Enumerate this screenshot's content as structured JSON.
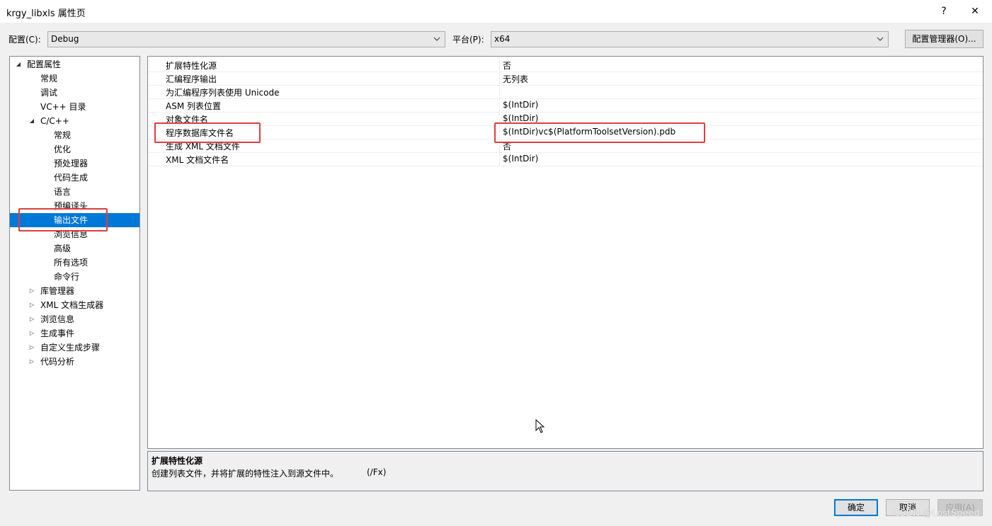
{
  "window": {
    "title": "krgy_libxls 属性页",
    "help_glyph": "?",
    "close_glyph": "✕"
  },
  "toolbar": {
    "config_label": "配置(C):",
    "config_value": "Debug",
    "platform_label": "平台(P):",
    "platform_value": "x64",
    "config_manager": "配置管理器(O)..."
  },
  "tree": {
    "items": [
      {
        "label": "配置属性",
        "arrow": "◢"
      },
      {
        "label": "常规"
      },
      {
        "label": "调试"
      },
      {
        "label": "VC++ 目录"
      },
      {
        "label": "C/C++",
        "arrow": "◢"
      },
      {
        "label": "常规"
      },
      {
        "label": "优化"
      },
      {
        "label": "预处理器"
      },
      {
        "label": "代码生成"
      },
      {
        "label": "语言"
      },
      {
        "label": "预编译头"
      },
      {
        "label": "输出文件",
        "selected": true
      },
      {
        "label": "浏览信息"
      },
      {
        "label": "高级"
      },
      {
        "label": "所有选项"
      },
      {
        "label": "命令行"
      },
      {
        "label": "库管理器",
        "arrow": "▷"
      },
      {
        "label": "XML 文档生成器",
        "arrow": "▷"
      },
      {
        "label": "浏览信息",
        "arrow": "▷"
      },
      {
        "label": "生成事件",
        "arrow": "▷"
      },
      {
        "label": "自定义生成步骤",
        "arrow": "▷"
      },
      {
        "label": "代码分析",
        "arrow": "▷"
      }
    ]
  },
  "grid": {
    "rows": [
      {
        "name": "扩展特性化源",
        "value": "否"
      },
      {
        "name": "汇编程序输出",
        "value": "无列表"
      },
      {
        "name": "为汇编程序列表使用 Unicode",
        "value": ""
      },
      {
        "name": "ASM 列表位置",
        "value": "$(IntDir)"
      },
      {
        "name": "对象文件名",
        "value": "$(IntDir)"
      },
      {
        "name": "程序数据库文件名",
        "value": "$(IntDir)vc$(PlatformToolsetVersion).pdb"
      },
      {
        "name": "生成 XML 文档文件",
        "value": "否"
      },
      {
        "name": "XML 文档文件名",
        "value": "$(IntDir)"
      }
    ]
  },
  "description": {
    "title": "扩展特性化源",
    "text": "创建列表文件，并将扩展的特性注入到源文件中。",
    "switch": "(/Fx)"
  },
  "buttons": {
    "ok": "确定",
    "cancel": "取消",
    "apply": "应用(A)"
  },
  "watermark": "CSDN @LostSpeed",
  "colors": {
    "selection": "#0078d7",
    "highlight_box": "#e03c3c",
    "ok_border": "#0078d7"
  }
}
